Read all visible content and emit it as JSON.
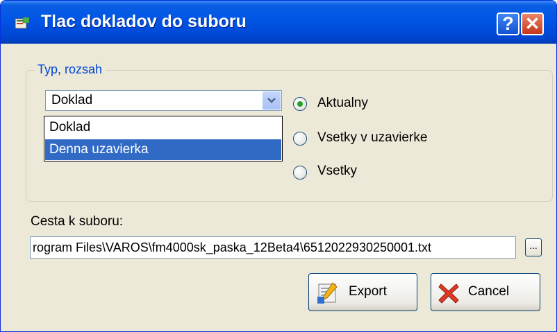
{
  "window": {
    "title": "Tlac dokladov do suboru",
    "help_symbol": "?",
    "close_symbol": "✕"
  },
  "group": {
    "legend": "Typ, rozsah",
    "combo": {
      "value": "Doklad",
      "options": [
        "Doklad",
        "Denna uzavierka"
      ],
      "highlighted": "Denna uzavierka"
    },
    "radios": [
      {
        "label": "Aktualny",
        "checked": true
      },
      {
        "label": "Vsetky v uzavierke",
        "checked": false
      },
      {
        "label": "Vsetky",
        "checked": false
      }
    ]
  },
  "path": {
    "label": "Cesta k suboru:",
    "value": "rogram Files\\VAROS\\fm4000sk_paska_12Beta4\\6512022930250001.txt",
    "browse_label": "..."
  },
  "buttons": {
    "export_label": "Export",
    "cancel_label": "Cancel"
  },
  "colors": {
    "titlebar": "#0055e5",
    "selection": "#316ac5",
    "legend_text": "#0046d5"
  }
}
